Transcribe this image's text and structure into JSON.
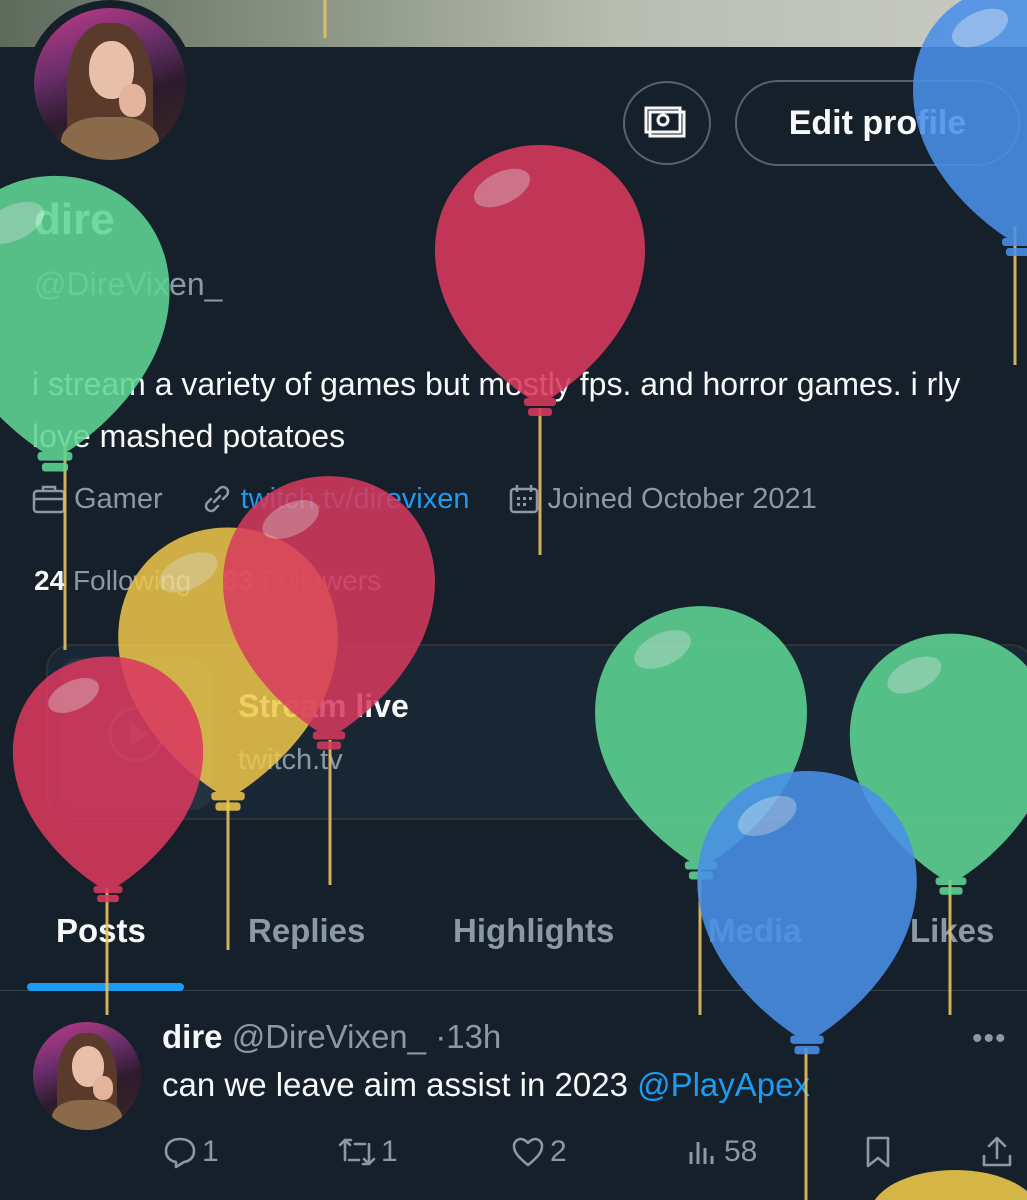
{
  "profile": {
    "name": "dire",
    "handle": "@DireVixen_",
    "bio": "i stream a variety of games but mostly fps. and horror games. i rly love mashed potatoes",
    "category": "Gamer",
    "link": "twitch.tv/direvixen",
    "joined": "Joined October 2021",
    "following_count": "24",
    "following_label": "Following",
    "followers_count": "83",
    "followers_label": "Followers",
    "edit_button_label": "Edit profile",
    "icons": [
      "money-icon",
      "briefcase-icon",
      "link-icon",
      "calendar-icon"
    ]
  },
  "card": {
    "title": "Stream live",
    "subtitle": "twitch.tv"
  },
  "tabs": [
    {
      "label": "Posts",
      "active": true
    },
    {
      "label": "Replies"
    },
    {
      "label": "Highlights"
    },
    {
      "label": "Media"
    },
    {
      "label": "Likes"
    }
  ],
  "post": {
    "author": "dire",
    "handle": "@DireVixen_",
    "separator": "·",
    "time": "13h",
    "text": "can we leave aim assist in 2023",
    "mention": "@PlayApex",
    "replies": "1",
    "reposts": "1",
    "likes": "2",
    "views": "58"
  },
  "colors": {
    "background": "#15202b",
    "accent": "#1d9bf0",
    "muted": "#8b98a5",
    "balloon_red": "#d9395e",
    "balloon_green": "#5ed594",
    "balloon_yellow": "#f0c94a",
    "balloon_blue": "#4a90e8"
  }
}
